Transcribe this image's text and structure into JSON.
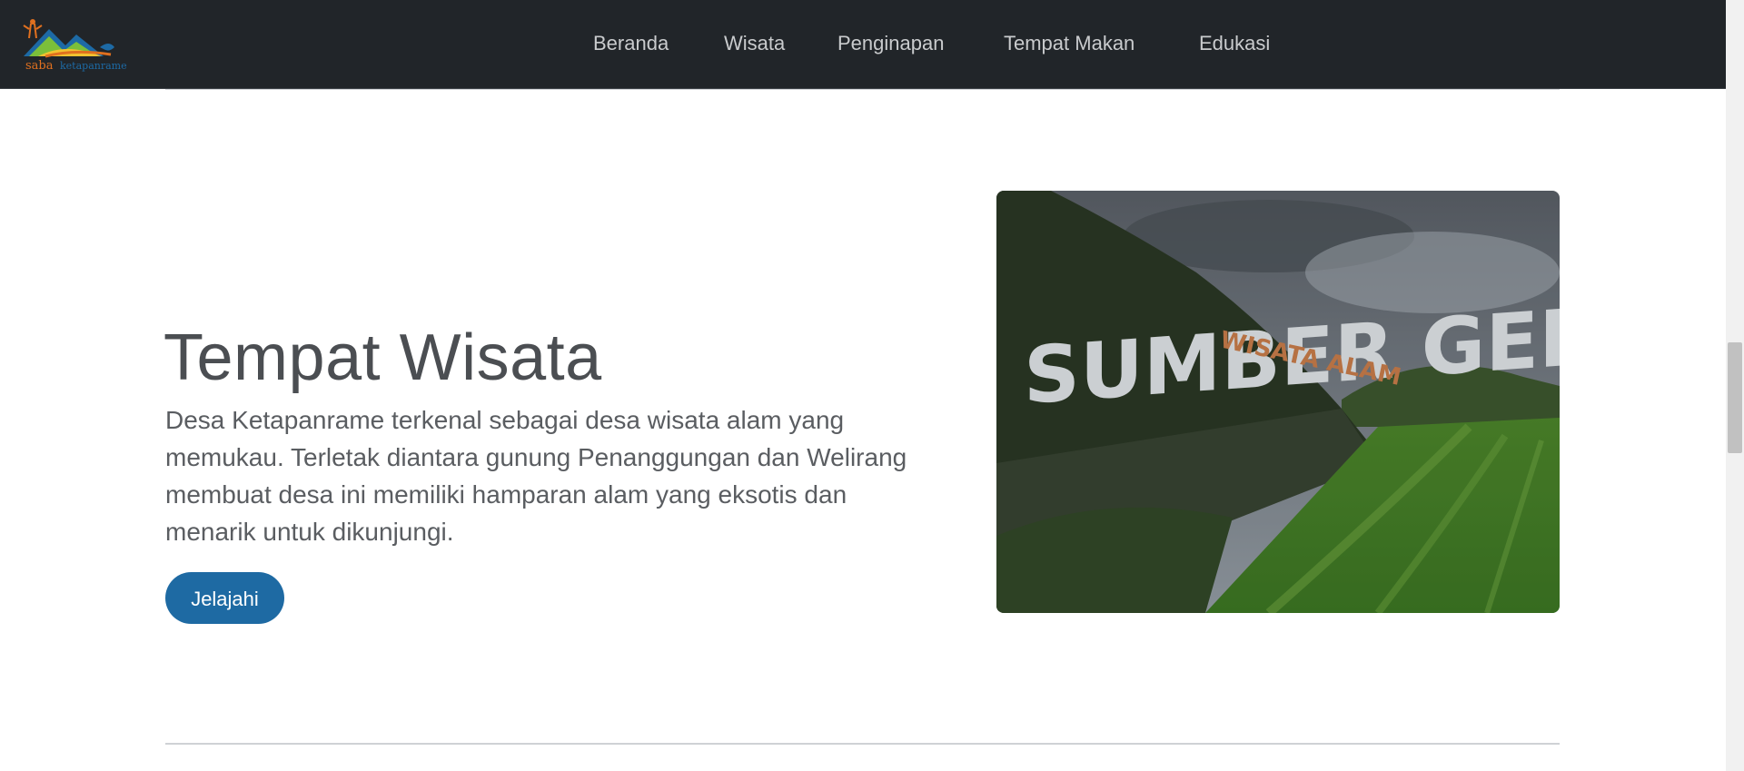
{
  "brand": {
    "logo_text_1": "saba",
    "logo_text_2": "ketapanrame",
    "colors": {
      "orange": "#e0701f",
      "blue": "#1d6aa5",
      "green": "#7bbf3a",
      "yellow": "#f2c230"
    }
  },
  "nav": {
    "items": [
      {
        "label": "Beranda"
      },
      {
        "label": "Wisata"
      },
      {
        "label": "Penginapan"
      },
      {
        "label": "Tempat Makan"
      },
      {
        "label": "Edukasi"
      }
    ]
  },
  "hero": {
    "title": "Tempat Wisata",
    "description": "Desa Ketapanrame terkenal sebagai desa wisata alam yang memukau. Terletak diantara gunung Penanggungan dan Welirang membuat desa ini memiliki hamparan alam yang eksotis dan menarik untuk dikunjungi.",
    "button_label": "Jelajahi",
    "photo": {
      "sign_text": "SUMBER GEN",
      "sign_subtext": "WISATA ALAM"
    }
  },
  "theme": {
    "navbar_bg": "#212529",
    "button_bg": "#1e6aa3",
    "text_color": "#4b4e52"
  }
}
